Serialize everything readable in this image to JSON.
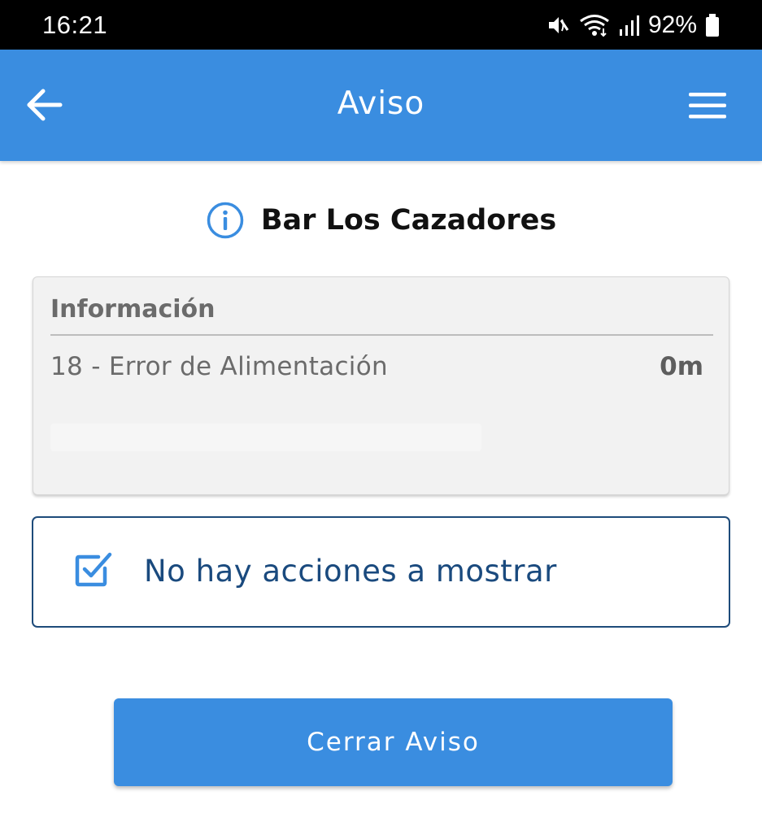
{
  "status_bar": {
    "time": "16:21",
    "battery_percent": "92%",
    "icons": [
      "mute-vibrate-icon",
      "wifi-icon",
      "signal-icon",
      "battery-icon"
    ]
  },
  "app_bar": {
    "title": "Aviso",
    "back_icon": "arrow-left-icon",
    "menu_icon": "hamburger-menu-icon",
    "color": "#3a8de0"
  },
  "heading": {
    "icon": "info-icon",
    "title": "Bar Los Cazadores"
  },
  "info_card": {
    "title": "Información",
    "items": [
      {
        "label": "18 - Error de Alimentación",
        "value": "0m"
      }
    ]
  },
  "actions": {
    "icon": "checkbox-checked-icon",
    "message": "No hay acciones a mostrar",
    "accent": "#1a4a7e"
  },
  "primary_action": {
    "label": "Cerrar Aviso",
    "color": "#3a8de0"
  }
}
